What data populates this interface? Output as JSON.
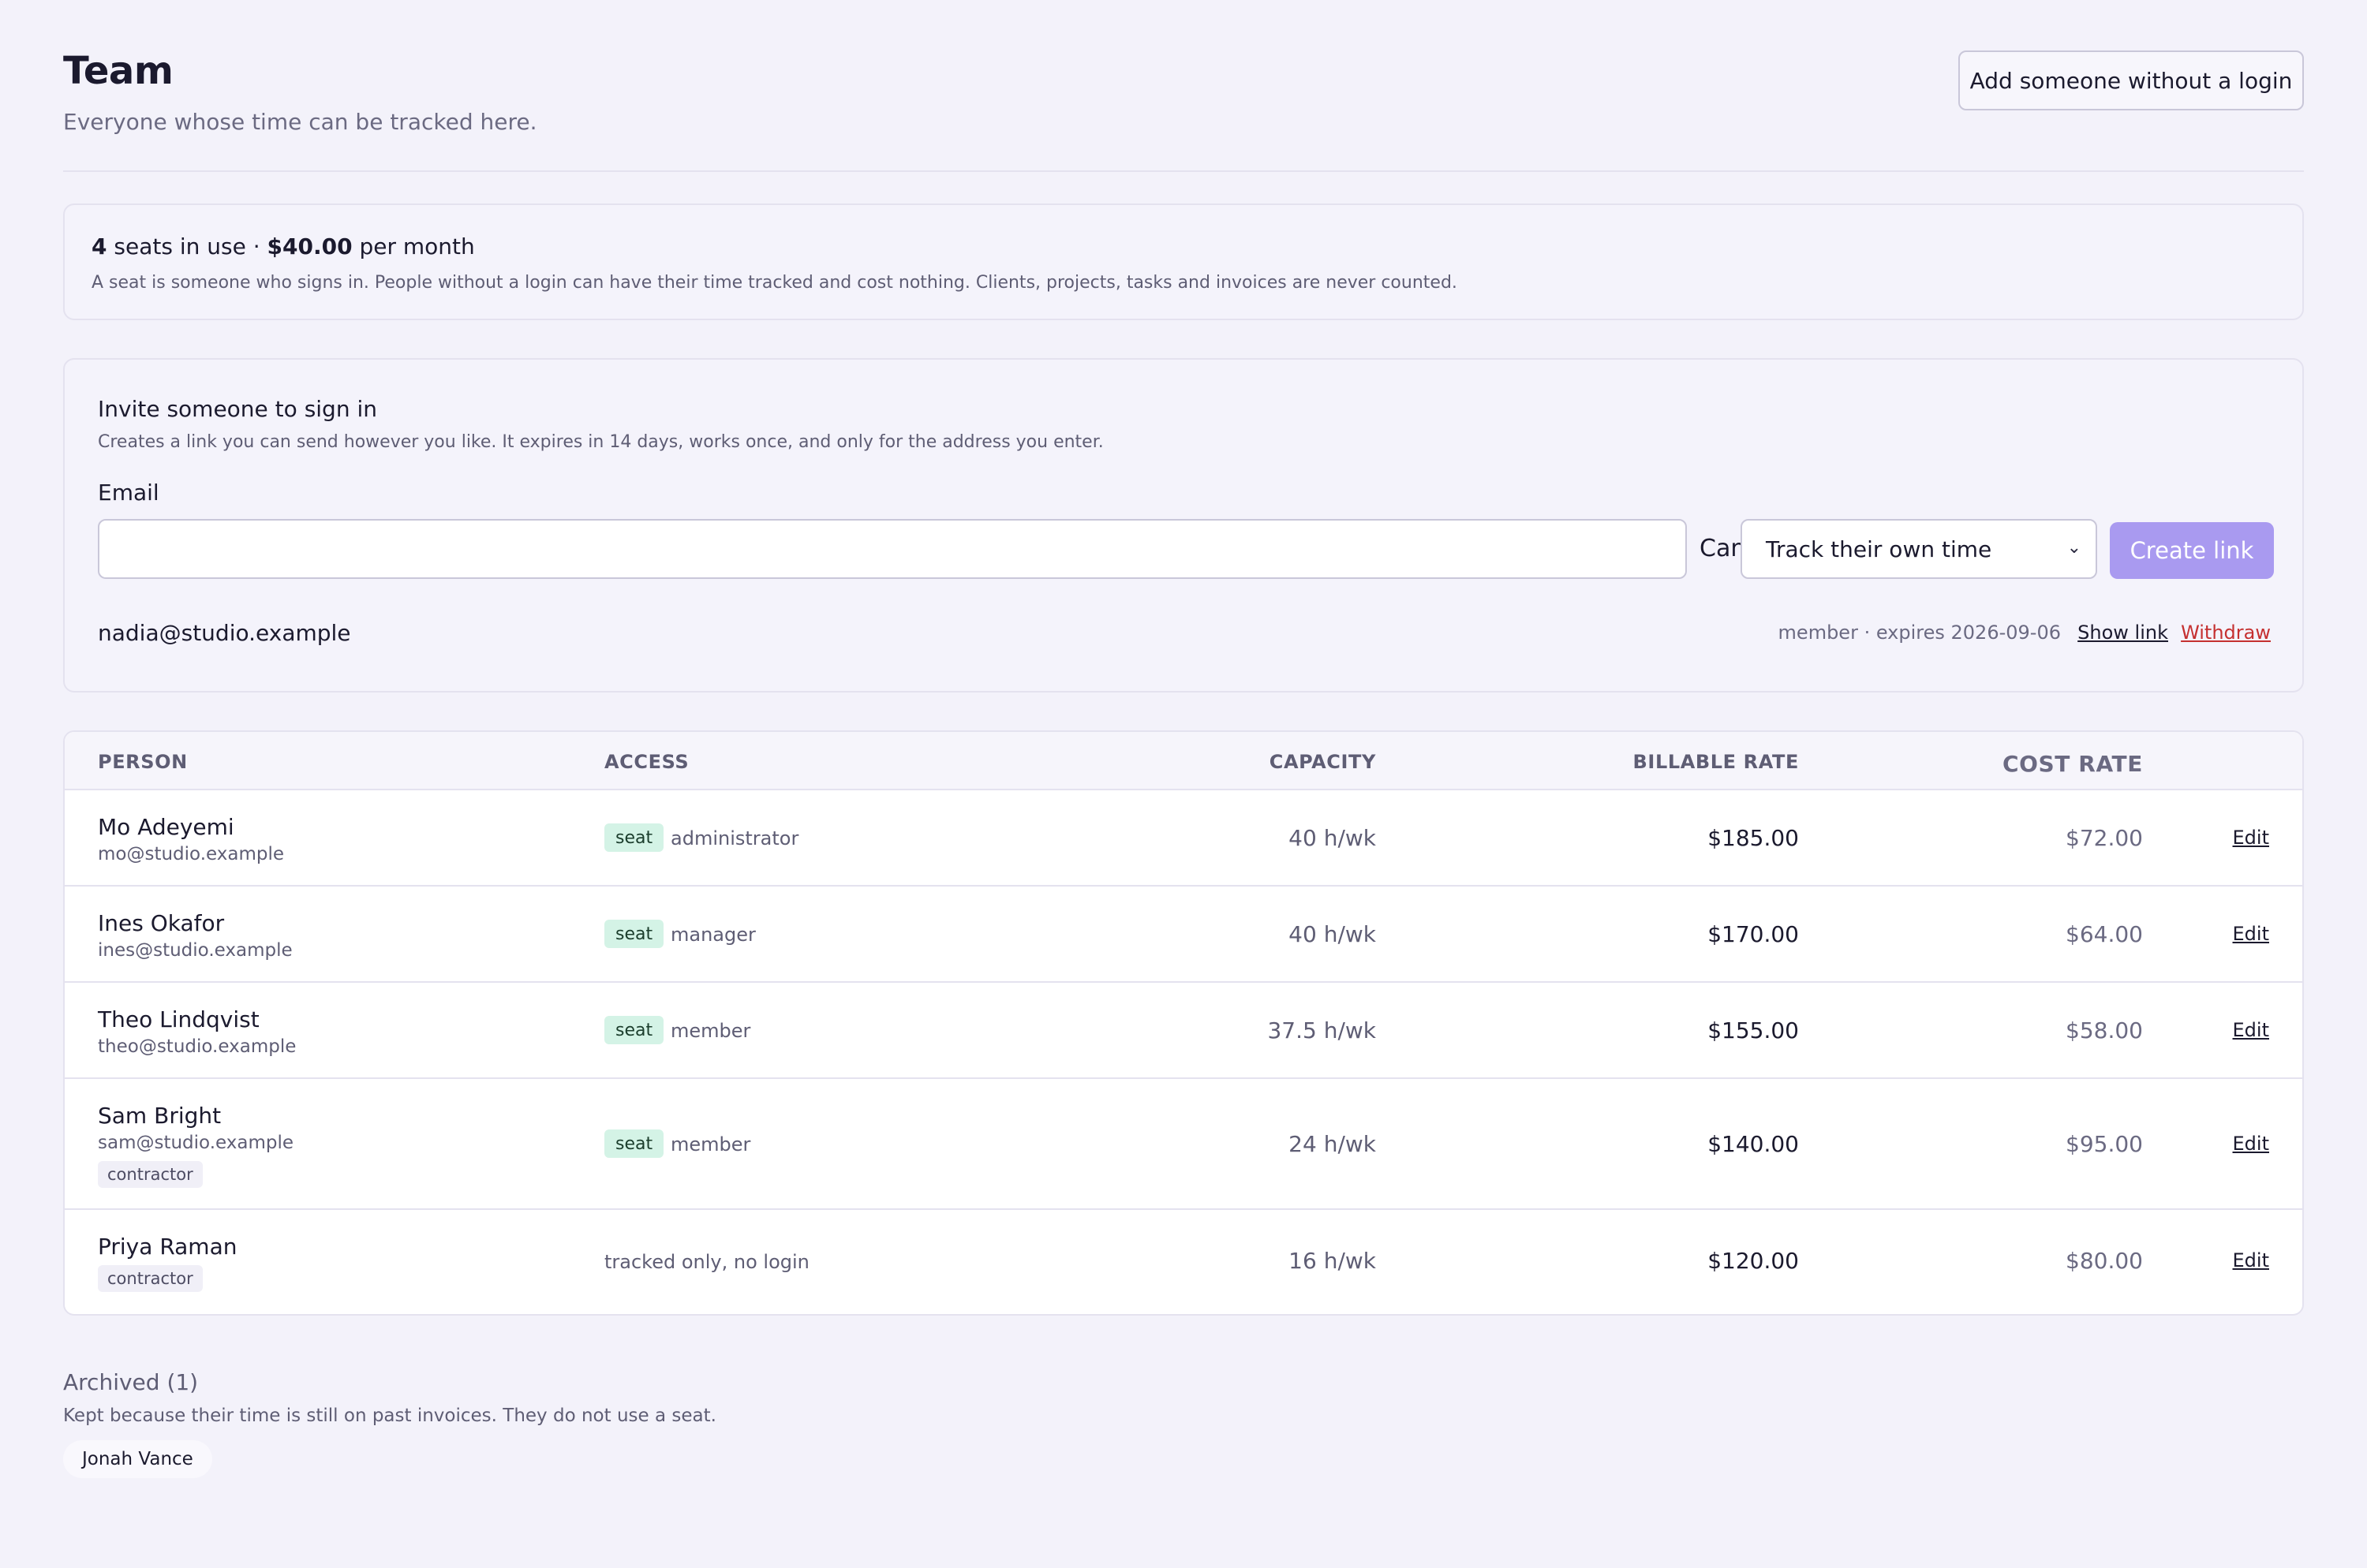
{
  "header": {
    "title": "Team",
    "subtitle": "Everyone whose time can be tracked here.",
    "add_button": "Add someone without a login"
  },
  "seats": {
    "count": "4",
    "in_use_text": " seats in use · ",
    "price": "$40.00",
    "per_month": " per month",
    "note": "A seat is someone who signs in. People without a login can have their time tracked and cost nothing. Clients, projects, tasks and invoices are never counted."
  },
  "invite": {
    "title": "Invite someone to sign in",
    "description": "Creates a link you can send however you like. It expires in 14 days, works once, and only for the address you enter.",
    "email_label": "Email",
    "email_value": "",
    "can_label": "Can",
    "role_selected": "Track their own time",
    "create_button": "Create link",
    "pending": {
      "email": "nadia@studio.example",
      "meta": "member · expires 2026-09-06",
      "show_link": "Show link",
      "withdraw": "Withdraw"
    }
  },
  "table": {
    "headers": {
      "person": "PERSON",
      "access": "ACCESS",
      "capacity": "CAPACITY",
      "billable": "BILLABLE RATE",
      "cost": "COST RATE"
    },
    "rows": [
      {
        "name": "Mo Adeyemi",
        "email": "mo@studio.example",
        "seat": "seat",
        "role": "administrator",
        "capacity": "40 h/wk",
        "billable": "$185.00",
        "cost": "$72.00",
        "edit": "Edit"
      },
      {
        "name": "Ines Okafor",
        "email": "ines@studio.example",
        "seat": "seat",
        "role": "manager",
        "capacity": "40 h/wk",
        "billable": "$170.00",
        "cost": "$64.00",
        "edit": "Edit"
      },
      {
        "name": "Theo Lindqvist",
        "email": "theo@studio.example",
        "seat": "seat",
        "role": "member",
        "capacity": "37.5 h/wk",
        "billable": "$155.00",
        "cost": "$58.00",
        "edit": "Edit"
      },
      {
        "name": "Sam Bright",
        "email": "sam@studio.example",
        "tag": "contractor",
        "seat": "seat",
        "role": "member",
        "capacity": "24 h/wk",
        "billable": "$140.00",
        "cost": "$95.00",
        "edit": "Edit"
      },
      {
        "name": "Priya Raman",
        "tag": "contractor",
        "access_text": "tracked only, no login",
        "capacity": "16 h/wk",
        "billable": "$120.00",
        "cost": "$80.00",
        "edit": "Edit"
      }
    ]
  },
  "archived": {
    "title": "Archived (1)",
    "description": "Kept because their time is still on past invoices. They do not use a seat.",
    "people": [
      "Jonah Vance"
    ]
  }
}
